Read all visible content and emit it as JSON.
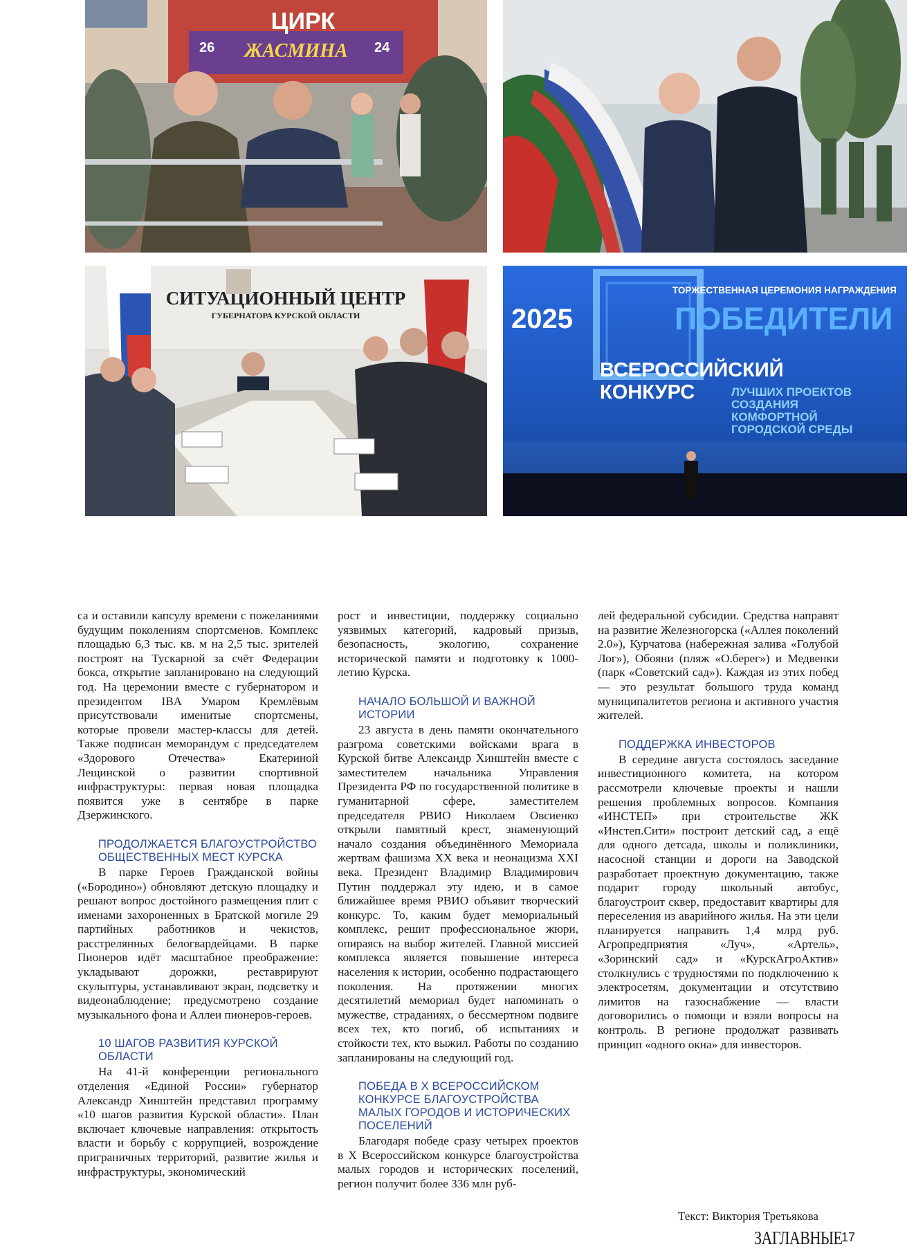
{
  "photos": {
    "circus": {
      "sign": "ЦИРК",
      "banner_title": "ЖАСМИНА",
      "banner_left_date": "26",
      "banner_right_date": "24"
    },
    "situation_center": {
      "title_line1": "СИТУАЦИОННЫЙ ЦЕНТР",
      "title_line2": "ГУБЕРНАТОРА КУРСКОЙ ОБЛАСТИ"
    },
    "award": {
      "year": "2025",
      "ceremony": "ТОРЖЕСТВЕННАЯ ЦЕРЕМОНИЯ НАГРАЖДЕНИЯ",
      "winners": "ПОБЕДИТЕЛИ",
      "contest_line1": "ВСЕРОССИЙСКИЙ",
      "contest_line2": "КОНКУРС",
      "sub_line1": "ЛУЧШИХ ПРОЕКТОВ",
      "sub_line2": "СОЗДАНИЯ",
      "sub_line3": "КОМФОРТНОЙ",
      "sub_line4": "ГОРОДСКОЙ СРЕДЫ"
    }
  },
  "col1": {
    "p1": "са и оставили капсулу времени с пожеланиями будущим поколениям спортсменов. Комплекс площадью 6,3 тыс. кв. м на 2,5 тыс. зрителей построят на Тускарной за счёт Федерации бокса, открытие запланировано на следующий год. На церемонии вместе с губернатором и президентом IBA Умаром Кремлёвым присутствовали именитые спортсмены, которые провели мастер-классы для детей. Также подписан меморандум с председателем «Здорового Отечества» Екатериной Лещинской о развитии спортивной инфраструктуры: первая новая площадка появится уже в сентябре в парке Дзержинского.",
    "h1": "Продолжается благоустройство общественных мест Курска",
    "p2": "В парке Героев Гражданской войны («Бородино») обновляют детскую площадку и решают вопрос достойного размещения плит с именами захороненных в Братской могиле 29 партийных работников и чекистов, расстрелянных белогвардейцами. В парке Пионеров идёт масштабное преображение: укладывают дорожки, реставрируют скульптуры, устанавливают экран, подсветку и видеонаблюдение; предусмотрено создание музыкального фона и Аллеи пионеров-героев.",
    "h2": "10 шагов развития Курской области",
    "p3": "На 41-й конференции регионального отделения «Единой России» губернатор Александр Хинштейн представил программу «10 шагов развития Курской области». План включает ключевые направления: открытость власти и борьбу с коррупцией, возрождение приграничных территорий, развитие жилья и инфраструктуры, экономический"
  },
  "col2": {
    "p1": "рост и инвестиции, поддержку социально уязвимых категорий, кадровый призыв, безопасность, экологию, сохранение исторической памяти и подготовку к 1000-летию Курска.",
    "h1": "Начало большой и важной истории",
    "p2": "23 августа в день памяти окончательного разгрома советскими войсками врага в Курской битве Александр Хинштейн вместе с заместителем начальника Управления Президента РФ по государственной политике в гуманитарной сфере, заместителем председателя РВИО Николаем Овсиенко открыли памятный крест, знаменующий начало создания объединённого Мемориала жертвам фашизма XX века и неонацизма XXI века. Президент Владимир Владимирович Путин поддержал эту идею, и в самое ближайшее время РВИО объявит творческий конкурс. То, каким будет мемориальный комплекс, решит профессиональное жюри, опираясь на выбор жителей. Главной миссией комплекса является повышение интереса населения к истории, особенно подрастающего поколения. На протяжении многих десятилетий мемориал будет напоминать о мужестве, страданиях, о бессмертном подвиге всех тех, кто погиб, об испытаниях и стойкости тех, кто выжил. Работы по созданию запланированы на следующий год.",
    "h2": "Победа в X Всероссийском конкурсе благоустройства малых городов и исторических поселений",
    "p3": "Благодаря победе сразу четырех проектов в X Всероссийском конкурсе благоустройства малых городов и исторических поселений, регион получит более 336 млн руб-"
  },
  "col3": {
    "p1": "лей федеральной субсидии. Средства направят на развитие Железногорска («Аллея поколений 2.0»), Курчатова (набережная залива «Голубой Лог»), Обояни (пляж «О.берег») и Медвенки (парк «Советский сад»). Каждая из этих побед — это результат большого труда команд муниципалитетов региона и активного участия жителей.",
    "h1": "Поддержка инвесторов",
    "p2": "В середине августа состоялось заседание инвестиционного комитета, на котором рассмотрели ключевые проекты и нашли решения проблемных вопросов. Компания «ИНСТЕП» при строительстве ЖК «Инстеп.Сити» построит детский сад, а ещё для одного детсада, школы и поликлиники, насосной станции и дороги на Заводской разработает проектную документацию, также подарит городу школьный автобус, благоустроит сквер, предоставит квартиры для переселения из аварийного жилья. На эти цели планируется направить 1,4 млрд руб. Агропредприятия «Луч», «Артель», «Зоринский сад» и «КурскАгроАктив» столкнулись с трудностями по подключению к электросетям, документации и отсутствию лимитов на газоснабжение — власти договорились о помощи и взяли вопросы на контроль. В регионе продолжат развивать принцип «одного окна» для инвесторов."
  },
  "footer": {
    "byline": "Текст: Виктория Третьякова",
    "masthead": "ЗАГЛАВНЫЕ",
    "page_number": "17"
  },
  "colors": {
    "heading": "#2a4a9b",
    "award_bg": "#1a4fb0"
  }
}
